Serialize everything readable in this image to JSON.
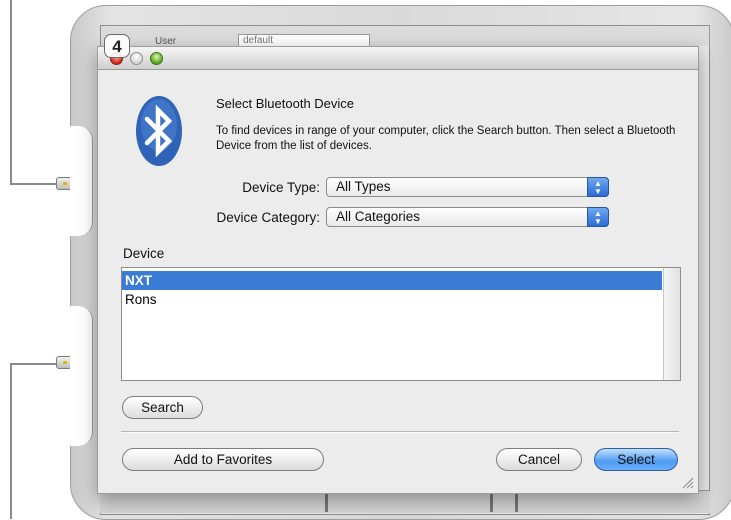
{
  "step": {
    "number": "4"
  },
  "background_window": {
    "field_label": "User",
    "field_value": "default"
  },
  "dialog": {
    "title": "Select Bluetooth Device",
    "description": "To find devices in range of your computer, click the Search button. Then select a Bluetooth Device from the list of devices.",
    "device_type": {
      "label": "Device Type:",
      "value": "All Types"
    },
    "device_category": {
      "label": "Device Category:",
      "value": "All Categories"
    },
    "list": {
      "header": "Device",
      "items": [
        {
          "label": "NXT",
          "selected": true
        },
        {
          "label": "Rons",
          "selected": false
        }
      ]
    },
    "buttons": {
      "search": "Search",
      "add_favorites": "Add to Favorites",
      "cancel": "Cancel",
      "select": "Select"
    }
  },
  "colors": {
    "selection": "#3a7bd5",
    "bluetooth": "#2e63b8",
    "default_button": "#4d9bf0"
  },
  "icons": [
    "bluetooth-icon",
    "close-light-icon",
    "minimize-light-icon",
    "zoom-light-icon",
    "popup-arrows-icon",
    "resize-grip-icon"
  ]
}
